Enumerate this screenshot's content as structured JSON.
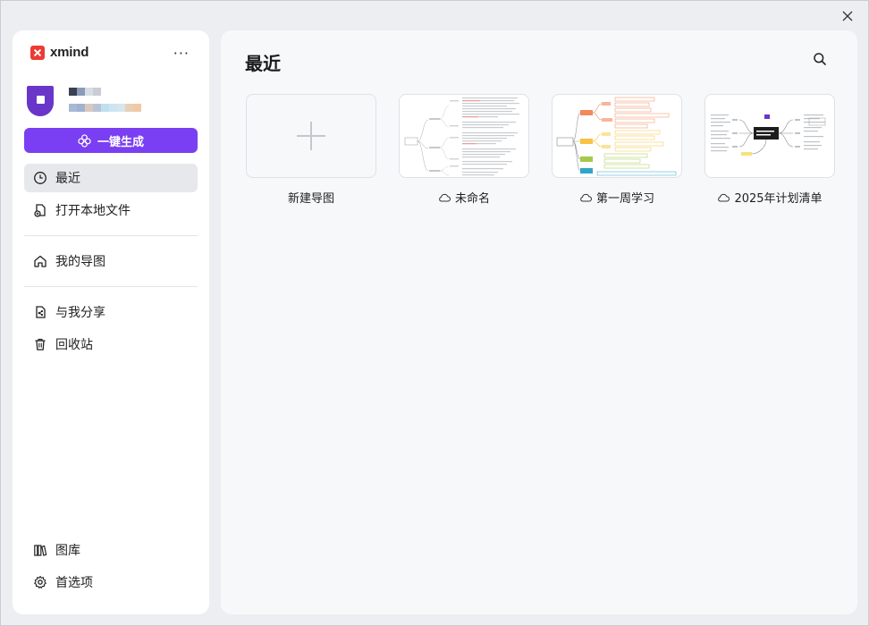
{
  "app": {
    "brand_name": "xmind"
  },
  "sidebar": {
    "generate_label": "一键生成",
    "items": [
      {
        "label": "最近",
        "icon": "clock-icon",
        "active": true
      },
      {
        "label": "打开本地文件",
        "icon": "open-file-icon"
      },
      {
        "label": "我的导图",
        "icon": "home-icon"
      },
      {
        "label": "与我分享",
        "icon": "shared-file-icon"
      },
      {
        "label": "回收站",
        "icon": "trash-icon"
      }
    ],
    "bottom_items": [
      {
        "label": "图库",
        "icon": "library-icon"
      },
      {
        "label": "首选项",
        "icon": "gear-icon"
      }
    ]
  },
  "main": {
    "title": "最近",
    "cards": [
      {
        "label": "新建导图",
        "type": "new"
      },
      {
        "label": "未命名",
        "cloud": true
      },
      {
        "label": "第一周学习",
        "cloud": true
      },
      {
        "label": "2025年计划清单",
        "cloud": true
      }
    ]
  },
  "colors": {
    "accent": "#7a3ff2",
    "brand": "#ec3b33",
    "avatar": "#6a36c9"
  }
}
